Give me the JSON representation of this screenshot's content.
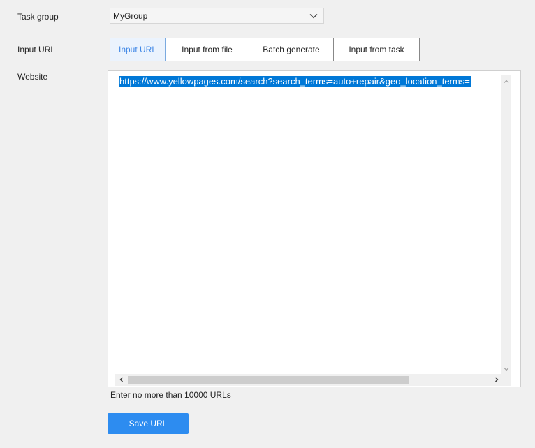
{
  "task_group": {
    "label": "Task group",
    "selected": "MyGroup"
  },
  "input_url": {
    "label": "Input URL",
    "tabs": [
      {
        "label": "Input URL",
        "active": true
      },
      {
        "label": "Input from file",
        "active": false
      },
      {
        "label": "Batch generate",
        "active": false
      },
      {
        "label": "Input from task",
        "active": false
      }
    ]
  },
  "website": {
    "label": "Website",
    "url_text": "https://www.yellowpages.com/search?search_terms=auto+repair&geo_location_terms=",
    "hint": "Enter no more than 10000 URLs"
  },
  "actions": {
    "save_label": "Save URL"
  },
  "colors": {
    "accent": "#2d8cf0",
    "active_tab_text": "#3f87e6",
    "selection": "#0078d7"
  }
}
